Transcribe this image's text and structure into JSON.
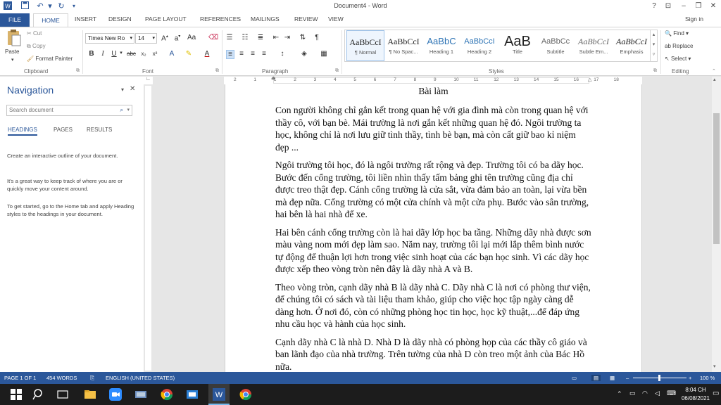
{
  "window": {
    "title": "Document4 - Word",
    "sign_in": "Sign in",
    "help": "?"
  },
  "tabs": [
    "FILE",
    "HOME",
    "INSERT",
    "DESIGN",
    "PAGE LAYOUT",
    "REFERENCES",
    "MAILINGS",
    "REVIEW",
    "VIEW"
  ],
  "clipboard": {
    "paste": "Paste",
    "cut": "Cut",
    "copy": "Copy",
    "format_painter": "Format Painter",
    "label": "Clipboard"
  },
  "font": {
    "family": "Times New Ro",
    "size": "14",
    "label": "Font"
  },
  "paragraph": {
    "label": "Paragraph"
  },
  "styles": {
    "label": "Styles",
    "items": [
      {
        "sample": "AaBbCcI",
        "name": "¶ Normal"
      },
      {
        "sample": "AaBbCcI",
        "name": "¶ No Spac..."
      },
      {
        "sample": "AaBbC",
        "name": "Heading 1"
      },
      {
        "sample": "AaBbCcI",
        "name": "Heading 2"
      },
      {
        "sample": "AaB",
        "name": "Title"
      },
      {
        "sample": "AaBbCc",
        "name": "Subtitle"
      },
      {
        "sample": "AaBbCcI",
        "name": "Subtle Em..."
      },
      {
        "sample": "AaBbCcI",
        "name": "Emphasis"
      }
    ]
  },
  "editing": {
    "find": "Find",
    "replace": "Replace",
    "select": "Select",
    "label": "Editing"
  },
  "navigation": {
    "title": "Navigation",
    "search_placeholder": "Search document",
    "tabs": [
      "HEADINGS",
      "PAGES",
      "RESULTS"
    ],
    "help": [
      "Create an interactive outline of your document.",
      "It's a great way to keep track of where you are or quickly move your content around.",
      "To get started, go to the Home tab and apply Heading styles to the headings in your document."
    ]
  },
  "ruler": [
    "2",
    "1",
    "1",
    "2",
    "3",
    "4",
    "5",
    "6",
    "7",
    "8",
    "9",
    "10",
    "11",
    "12",
    "13",
    "14",
    "15",
    "16",
    "17",
    "18"
  ],
  "document": {
    "heading": "Bài làm",
    "paragraphs": [
      "Con người không chỉ gắn kết trong quan hệ với gia đình mà còn trong quan hệ với thầy cô, với bạn bè. Mái trường là nơi gắn kết những quan hệ đó. Ngôi trường ta học, không chỉ là nơi lưu giữ tình thầy, tình bè bạn, mà còn cất giữ bao kỉ niệm đẹp ...",
      "Ngôi trường tôi học, đó là ngôi trường rất rộng và đẹp. Trường tôi có ba dãy học. Bước đến cổng trường, tôi liền nhìn thấy tấm bảng ghi tên trường cũng địa chỉ được treo thật đẹp. Cánh cổng trường là cửa sắt, vừa đảm bảo an toàn, lại vừa bền mà đẹp nữa. Cổng trường có một cửa chính và một cửa phụ. Bước vào sân trường, hai bên là hai nhà để xe.",
      "Hai bên cánh cổng trường còn là hai dãy lớp học ba tầng. Những dãy nhà được sơn màu vàng nom mới đẹp làm sao. Năm nay, trường tôi lại mới lắp thêm bình nước tự động để thuận lợi hơn trong việc sinh hoạt của các bạn học sinh. Vì các dãy học được xếp theo vòng tròn nên đây là dãy nhà A và B.",
      "Theo vòng tròn, cạnh dãy nhà B là dãy nhà C. Dãy nhà C là nơi có phòng thư viện, để chúng tôi có sách và tài liệu tham khảo, giúp cho việc học tập ngày càng dễ dàng hơn. Ở nơi đó, còn có những phòng học tin học, học kỹ thuật,...để đáp ứng nhu cầu học và hành của học sinh.",
      "Cạnh dãy nhà C là nhà D. Nhà D là dãy nhà có phòng họp của các thầy cô giáo và ban lãnh đạo của nhà trường. Trên tường của nhà D còn treo một ảnh của Bác Hồ nữa."
    ]
  },
  "status": {
    "page": "PAGE 1 OF 1",
    "words": "454 WORDS",
    "language": "ENGLISH (UNITED STATES)",
    "zoom": "100 %"
  },
  "taskbar": {
    "time": "8:04 CH",
    "date": "06/08/2021"
  }
}
